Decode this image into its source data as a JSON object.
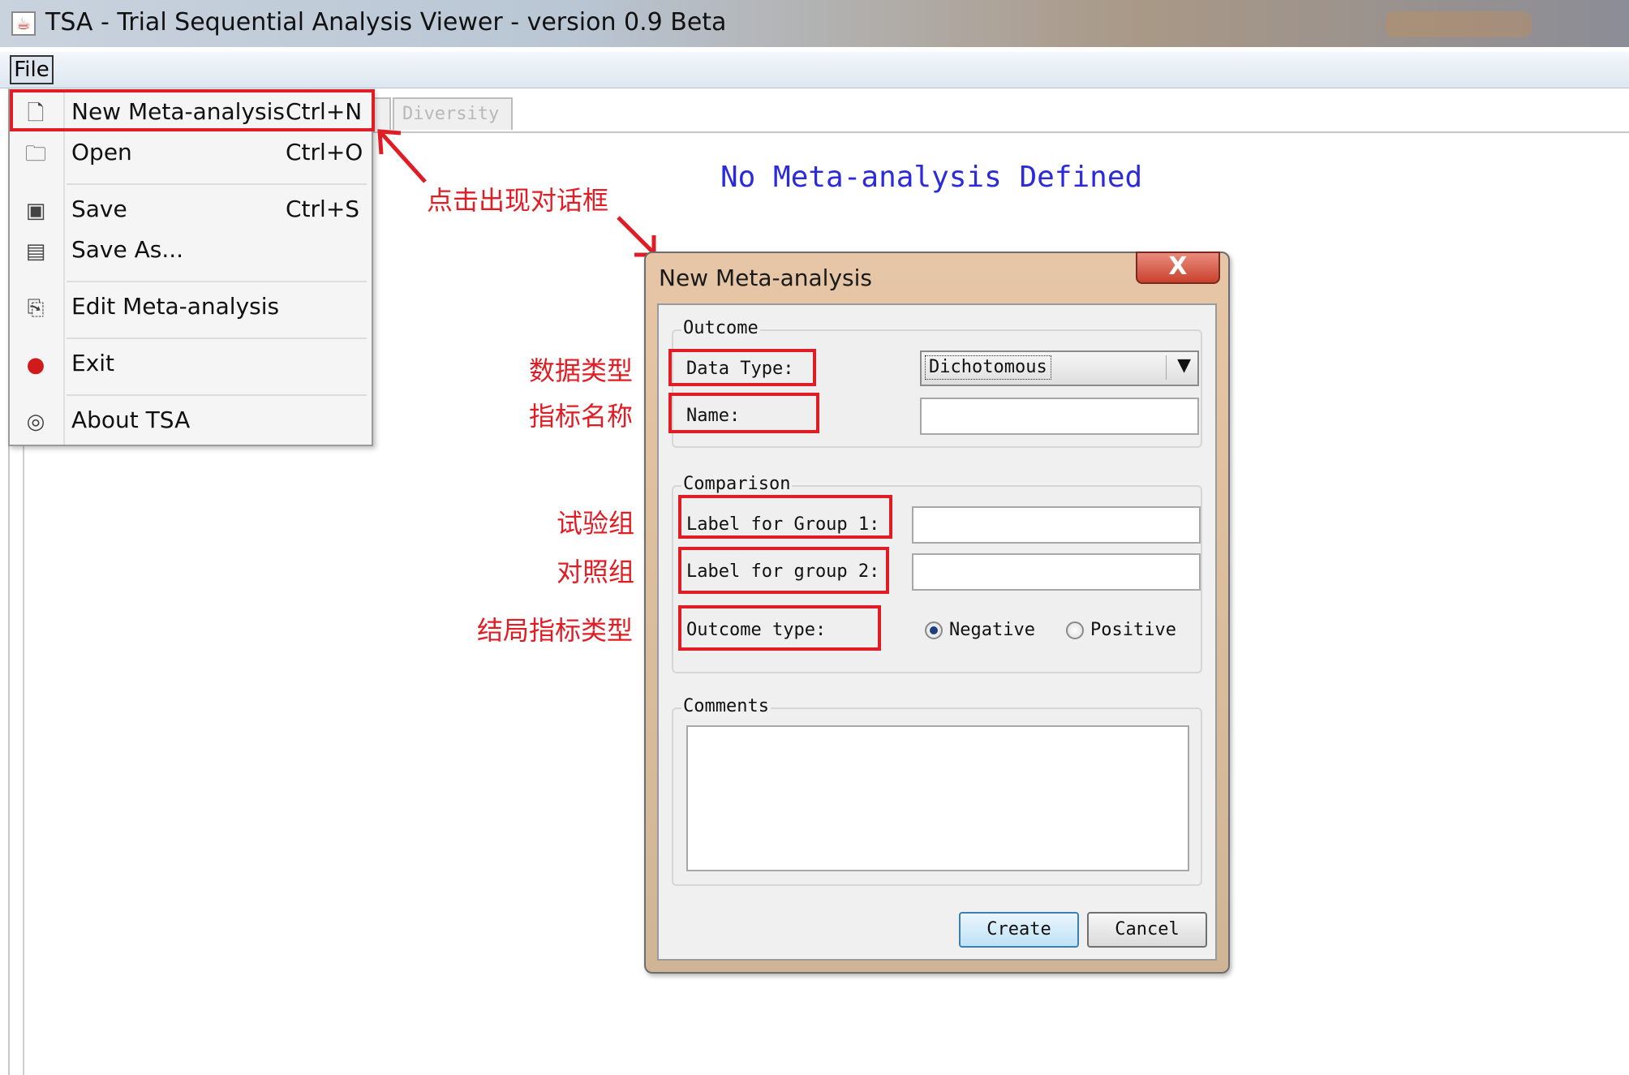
{
  "window": {
    "title": "TSA - Trial Sequential Analysis Viewer - version 0.9 Beta"
  },
  "menubar": {
    "file": "File"
  },
  "tabs": {
    "diversity": "Diversity"
  },
  "main": {
    "status_message": "No Meta-analysis Defined"
  },
  "file_menu": {
    "items": [
      {
        "label": "New Meta-analysis",
        "accelerator": "Ctrl+N",
        "icon": "new-document-icon"
      },
      {
        "label": "Open",
        "accelerator": "Ctrl+O",
        "icon": "open-folder-icon"
      },
      {
        "label": "Save",
        "accelerator": "Ctrl+S",
        "icon": "save-disk-icon"
      },
      {
        "label": "Save As...",
        "accelerator": "",
        "icon": "save-as-icon"
      },
      {
        "label": "Edit Meta-analysis",
        "accelerator": "",
        "icon": "edit-document-icon"
      },
      {
        "label": "Exit",
        "accelerator": "",
        "icon": "exit-icon"
      },
      {
        "label": "About TSA",
        "accelerator": "",
        "icon": "about-icon"
      }
    ]
  },
  "annotations": {
    "click_dialog": "点击出现对话框",
    "data_type": "数据类型",
    "name": "指标名称",
    "group1": "试验组",
    "group2": "对照组",
    "outcome_type": "结局指标类型"
  },
  "dialog": {
    "title": "New Meta-analysis",
    "close": "X",
    "outcome": {
      "legend": "Outcome",
      "data_type_label": "Data Type:",
      "data_type_value": "Dichotomous",
      "name_label": "Name:",
      "name_value": ""
    },
    "comparison": {
      "legend": "Comparison",
      "group1_label": "Label for Group 1:",
      "group1_value": "",
      "group2_label": "Label for group 2:",
      "group2_value": "",
      "outcome_type_label": "Outcome type:",
      "options": [
        "Negative",
        "Positive"
      ],
      "selected": "Negative"
    },
    "comments": {
      "legend": "Comments",
      "value": ""
    },
    "buttons": {
      "create": "Create",
      "cancel": "Cancel"
    }
  },
  "colors": {
    "highlight": "#e01c25",
    "status_text": "#2b2bdc",
    "dialog_frame": "#d9bb9b"
  }
}
